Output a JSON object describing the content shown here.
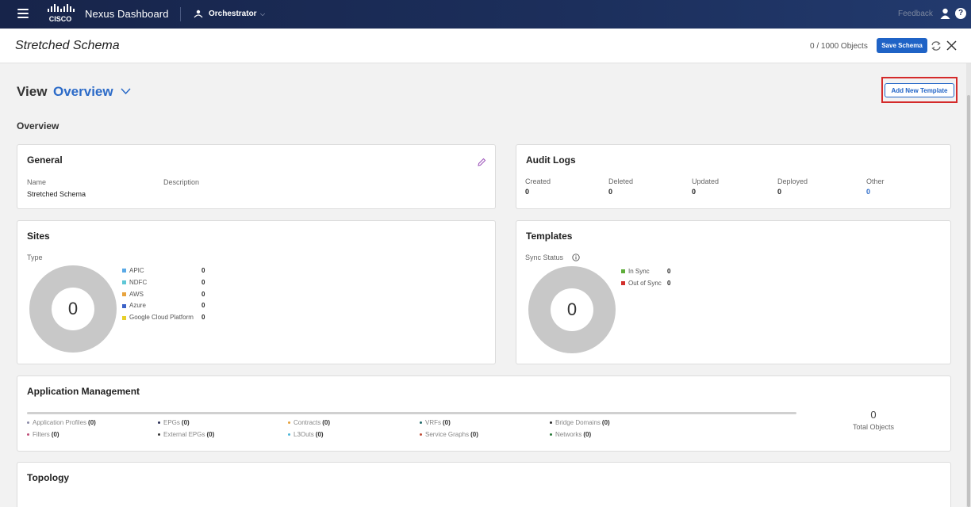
{
  "topbar": {
    "brand": "Nexus Dashboard",
    "service": "Orchestrator",
    "feedback": "Feedback",
    "help_glyph": "?"
  },
  "schema": {
    "title": "Stretched Schema",
    "objects_count": "0 / 1000 Objects",
    "save_label": "Save Schema"
  },
  "view": {
    "label": "View",
    "value": "Overview",
    "add_template_label": "Add New Template"
  },
  "section_title": "Overview",
  "general": {
    "title": "General",
    "name_label": "Name",
    "name_value": "Stretched Schema",
    "description_label": "Description"
  },
  "audit": {
    "title": "Audit Logs",
    "items": [
      {
        "label": "Created",
        "value": "0"
      },
      {
        "label": "Deleted",
        "value": "0"
      },
      {
        "label": "Updated",
        "value": "0"
      },
      {
        "label": "Deployed",
        "value": "0"
      },
      {
        "label": "Other",
        "value": "0"
      }
    ]
  },
  "sites": {
    "title": "Sites",
    "type_label": "Type",
    "total": "0",
    "legend": [
      {
        "label": "APIC",
        "value": "0",
        "color": "#5aa9e6"
      },
      {
        "label": "NDFC",
        "value": "0",
        "color": "#5fc7d6"
      },
      {
        "label": "AWS",
        "value": "0",
        "color": "#e8a33d"
      },
      {
        "label": "Azure",
        "value": "0",
        "color": "#3c62c7"
      },
      {
        "label": "Google Cloud Platform",
        "value": "0",
        "color": "#e7cf2a"
      }
    ]
  },
  "templates": {
    "title": "Templates",
    "sync_label": "Sync Status",
    "total": "0",
    "legend": [
      {
        "label": "In Sync",
        "value": "0",
        "color": "#5fae3a"
      },
      {
        "label": "Out of Sync",
        "value": "0",
        "color": "#d2302c"
      }
    ]
  },
  "app_mgmt": {
    "title": "Application Management",
    "total_value": "0",
    "total_label": "Total Objects",
    "items": [
      {
        "label": "Application Profiles",
        "count": "(0)",
        "color": "#8b8ba8"
      },
      {
        "label": "EPGs",
        "count": "(0)",
        "color": "#2a2f55"
      },
      {
        "label": "Contracts",
        "count": "(0)",
        "color": "#e5a03a"
      },
      {
        "label": "VRFs",
        "count": "(0)",
        "color": "#1f6a6a"
      },
      {
        "label": "Bridge Domains",
        "count": "(0)",
        "color": "#2a2a2a"
      },
      {
        "label": "Filters",
        "count": "(0)",
        "color": "#c0507a"
      },
      {
        "label": "External EPGs",
        "count": "(0)",
        "color": "#3a3a3a"
      },
      {
        "label": "L3Outs",
        "count": "(0)",
        "color": "#4fb7d8"
      },
      {
        "label": "Service Graphs",
        "count": "(0)",
        "color": "#c0503a"
      },
      {
        "label": "Networks",
        "count": "(0)",
        "color": "#2a7a3a"
      }
    ]
  },
  "topology": {
    "title": "Topology"
  },
  "colors": {
    "accent": "#1f63c6",
    "topbar": "#1c2f5c",
    "highlight": "#d42a2a"
  }
}
